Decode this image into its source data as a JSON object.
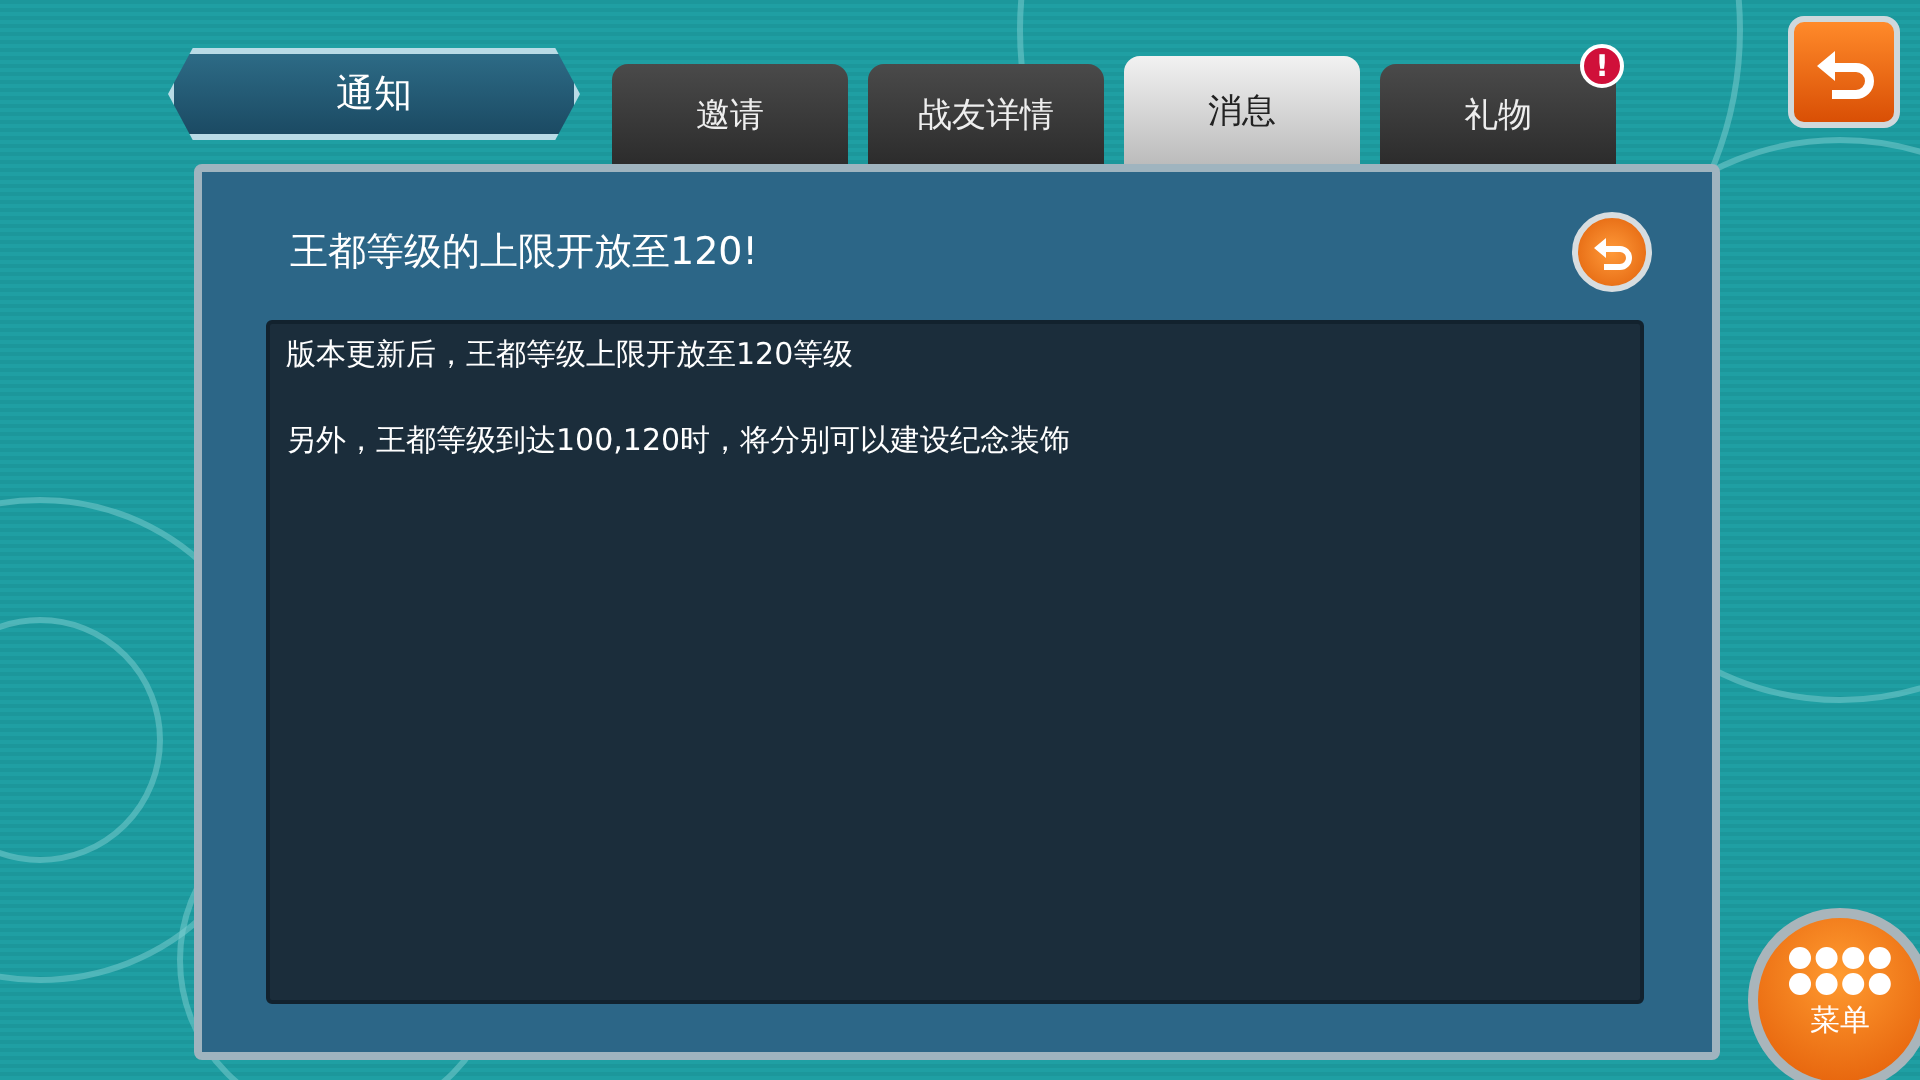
{
  "header": {
    "title": "通知"
  },
  "tabs": [
    {
      "label": "邀请",
      "selected": false
    },
    {
      "label": "战友详情",
      "selected": false
    },
    {
      "label": "消息",
      "selected": true
    },
    {
      "label": "礼物",
      "selected": false,
      "badge": "!"
    }
  ],
  "message": {
    "title": "王都等级的上限开放至120!",
    "paragraphs": [
      "版本更新后，王都等级上限开放至120等级",
      "另外，王都等级到达100,120时，将分别可以建设纪念装饰"
    ]
  },
  "menu_button": {
    "label": "菜单"
  }
}
